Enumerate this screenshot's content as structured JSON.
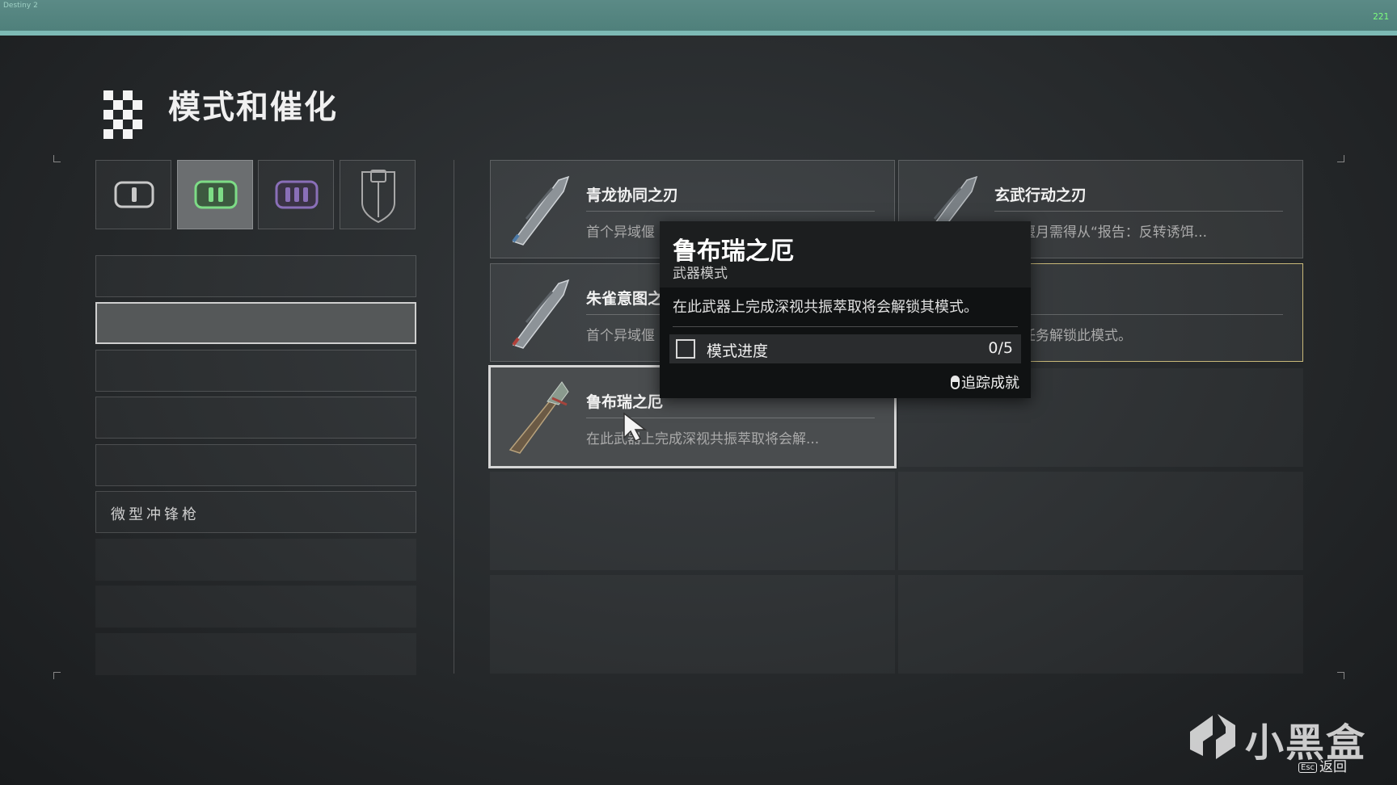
{
  "top_bar": {
    "left_text": "Destiny 2",
    "right_text": "221"
  },
  "page": {
    "title": "模式和催化"
  },
  "colors": {
    "accent_green": "#7ddc86",
    "accent_purple": "#8a6fb8",
    "highlight_gold": "#c9b979",
    "top_bar": "#5b8a86"
  },
  "category_tabs": [
    {
      "icon": "primary-ammo-icon",
      "active": false
    },
    {
      "icon": "special-ammo-icon",
      "active": true
    },
    {
      "icon": "heavy-ammo-icon",
      "active": false
    },
    {
      "icon": "armor-shield-icon",
      "active": false
    }
  ],
  "weapon_list": {
    "items": [
      "",
      "",
      "",
      "",
      "",
      "微型冲锋枪",
      "",
      "",
      ""
    ],
    "selected_index": 1
  },
  "mods": [
    {
      "name": "青龙协同之刃",
      "desc": "首个异域偃"
    },
    {
      "name": "玄武行动之刃",
      "desc": "异域偃月需得从“报告：反转诱饵..."
    },
    {
      "name": "朱雀意图之",
      "desc": "首个异域偃"
    },
    {
      "name": "",
      "desc": "一个任务解锁此模式。"
    },
    {
      "name": "鲁布瑞之厄",
      "desc": "在此武器上完成深视共振萃取将会解..."
    }
  ],
  "tooltip": {
    "title": "鲁布瑞之厄",
    "subtitle": "武器模式",
    "description": "在此武器上完成深视共振萃取将会解锁其模式。",
    "progress_label": "模式进度",
    "progress_value": "0/5",
    "progress_fraction": 0,
    "track_label": "追踪成就"
  },
  "footer": {
    "watermark": "小黑盒",
    "esc_key": "Esc",
    "back_label": "返回"
  }
}
